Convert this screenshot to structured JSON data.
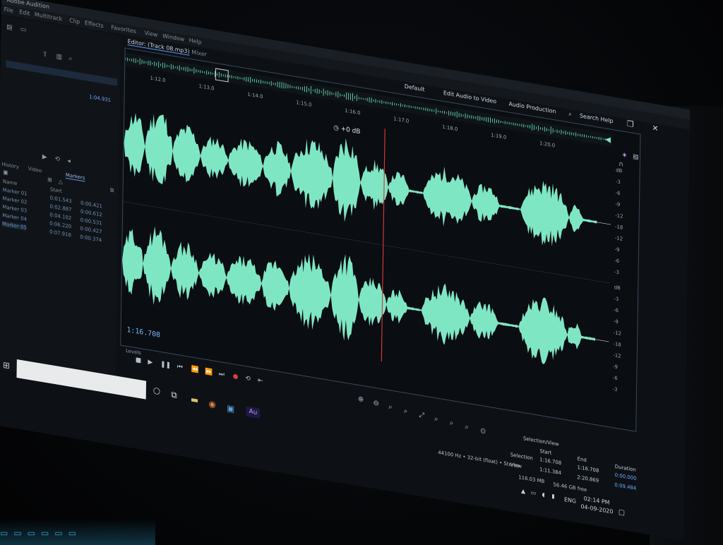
{
  "titlebar": {
    "app_title": "Adobe Audition"
  },
  "menubar": {
    "items": [
      "File",
      "Edit",
      "Multitrack",
      "Clip",
      "Effects",
      "Favorites",
      "View",
      "Window",
      "Help"
    ]
  },
  "left_panel": {
    "history_tab": "History",
    "video_tab": "Video",
    "markers_tab": "Markers",
    "rows": [
      {
        "name": "Marker 01",
        "start": "0:01.543",
        "dur": "0:00.421"
      },
      {
        "name": "Marker 02",
        "start": "0:02.887",
        "dur": "0:00.612"
      },
      {
        "name": "Marker 03",
        "start": "0:04.102",
        "dur": "0:00.531"
      },
      {
        "name": "Marker 04",
        "start": "0:06.220",
        "dur": "0:00.427"
      },
      {
        "name": "Marker 05",
        "start": "0:07.918",
        "dur": "0:00.374"
      }
    ],
    "file_size": "1:04.931",
    "start_header": "Start",
    "name_header": "Name"
  },
  "editor": {
    "tab_label": "Editor: (Track 08.mp3)",
    "mixer_tab": "Mixer",
    "ruler_labels": [
      "1:12.0",
      "1:13.0",
      "1:14.0",
      "1:15.0",
      "1:16.0",
      "1:17.0",
      "1:18.0",
      "1:19.0",
      "1:20.0"
    ],
    "gain_readout": "+0 dB",
    "timecode": "1:16.708",
    "levels_label": "Levels",
    "db_labels_top": [
      "dB",
      "-3",
      "-6",
      "-9",
      "-12",
      "-18",
      "-12",
      "-9",
      "-6",
      "-3"
    ],
    "db_labels_bottom": [
      "dB",
      "-3",
      "-6",
      "-9",
      "-12",
      "-18",
      "-12",
      "-9",
      "-6",
      "-3"
    ]
  },
  "workspace": {
    "default": "Default",
    "edit_audio_to_video": "Edit Audio to Video",
    "audio_production": "Audio Production",
    "search_help": "Search Help"
  },
  "selection_view": {
    "title": "Selection/View",
    "start_header": "Start",
    "end_header": "End",
    "duration_header": "Duration",
    "selection_label": "Selection",
    "view_label": "View",
    "sel_start": "1:16.708",
    "sel_end": "1:16.708",
    "sel_duration": "0:00.000",
    "view_start": "1:11.384",
    "view_end": "2:20.869",
    "view_duration": "0:09.484",
    "file_info": "44100 Hz • 32-bit (float) • Stereo",
    "file_size": "116.03 MB",
    "free_space": "56.46 GB free"
  },
  "taskbar": {
    "time": "02:14 PM",
    "date": "04-09-2020",
    "language": "ENG",
    "audition_icon_label": "Au"
  },
  "colors": {
    "waveform": "#7fe6c4",
    "playhead": "#d23a3a",
    "accent": "#5c9dff"
  }
}
